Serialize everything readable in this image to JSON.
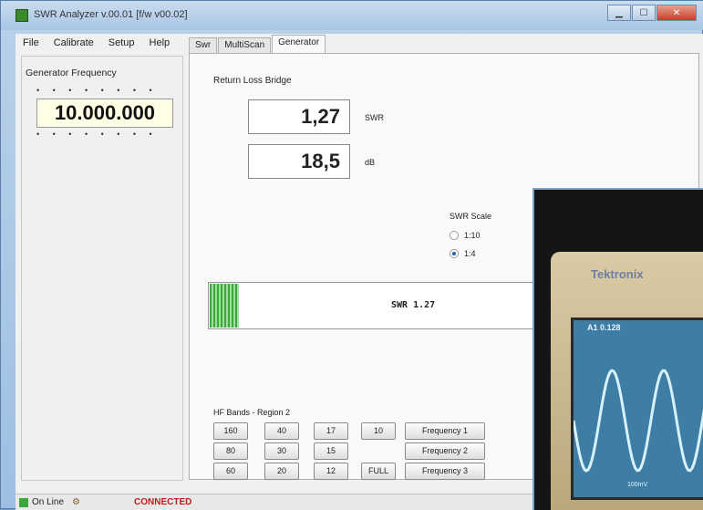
{
  "window": {
    "title": "SWR Analyzer v.00.01 [f/w v00.02]"
  },
  "menu": {
    "items": [
      "File",
      "Calibrate",
      "Setup",
      "Help"
    ]
  },
  "left": {
    "freq_label": "Generator Frequency",
    "dots": "• • • • • • • •",
    "frequency": "10.000.000"
  },
  "tabs": [
    "Swr",
    "MultiScan",
    "Generator"
  ],
  "generator": {
    "section_label": "Return Loss Bridge",
    "swr_value": "1,27",
    "swr_unit": "SWR",
    "db_value": "18,5",
    "db_unit": "dB",
    "scale_label": "SWR Scale",
    "scale_options": [
      "1:10",
      "1:4"
    ],
    "selected_scale": "1:4",
    "meter_text": "SWR 1.27",
    "meter_fraction": 0.09,
    "hf_label": "HF Bands - Region 2",
    "band_rows": [
      [
        "160",
        "40",
        "17",
        "10"
      ],
      [
        "80",
        "30",
        "15",
        ""
      ],
      [
        "60",
        "20",
        "12",
        "FULL"
      ]
    ],
    "freq_buttons": [
      "Frequency 1",
      "Frequency 2",
      "Frequency 3"
    ]
  },
  "status": {
    "online": "On Line",
    "connection": "CONNECTED"
  },
  "photo": {
    "brand": "Tektronix",
    "readout": "A1  0.128",
    "foot": "100mV"
  },
  "colors": {
    "connected": "#c21a1a",
    "meter_fill": "#3aa83a",
    "scope_screen": "#3f7ea4"
  }
}
